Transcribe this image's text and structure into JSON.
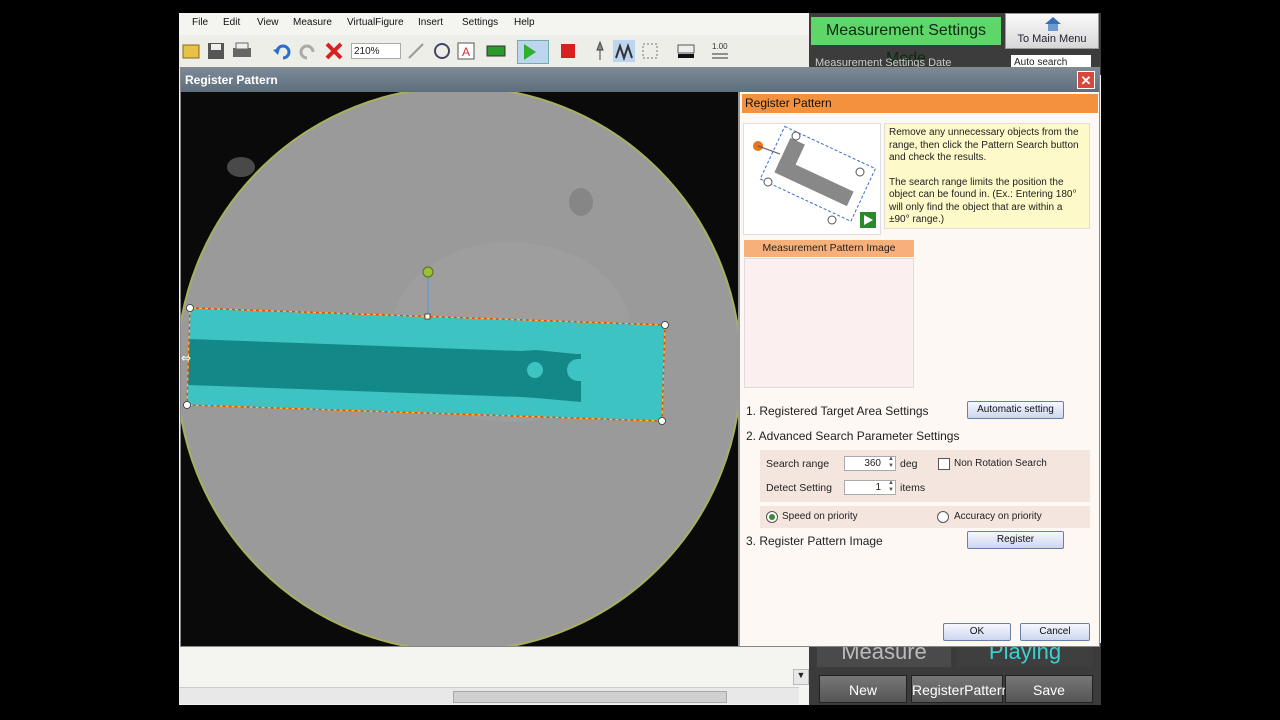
{
  "menu": [
    "File",
    "Edit",
    "View",
    "Measure",
    "VirtualFigure",
    "Insert",
    "Settings",
    "Help"
  ],
  "toolbar": {
    "zoom": "210%",
    "icons": [
      "open-icon",
      "save-icon",
      "print-icon",
      "undo-icon",
      "redo-icon",
      "delete-icon",
      "draw-icon",
      "measure-tool-icon",
      "text-icon",
      "grid-icon",
      "play-icon",
      "stop-icon",
      "edge-icon",
      "filter-icon",
      "select-icon",
      "line-color-icon",
      "line-width-icon"
    ],
    "line_width": "1.00"
  },
  "mode": {
    "label": "Measurement Settings Mode",
    "main_menu": "To Main Menu",
    "settings_date": "Measurement Settings Date",
    "auto_search": "Auto search"
  },
  "dialog": {
    "title": "Register Pattern",
    "close": "✕",
    "panel_title": "Register Pattern",
    "help_p1": "Remove any unnecessary objects from the range, then click the Pattern Search button and check the results.",
    "help_p2": "The search range limits the position the object can be found in. (Ex.: Entering 180° will only find the object that are within a ±90° range.)",
    "pattern_image_label": "Measurement Pattern Image",
    "sec1": "1. Registered Target Area Settings",
    "auto_setting": "Automatic setting",
    "sec2": "2. Advanced Search Parameter Settings",
    "search_range_label": "Search range",
    "search_range_value": "360",
    "search_range_unit": "deg",
    "non_rotation": "Non Rotation Search",
    "detect_label": "Detect Setting",
    "detect_value": "1",
    "detect_unit": "items",
    "speed_priority": "Speed on priority",
    "accuracy_priority": "Accuracy on priority",
    "sec3": "3. Register Pattern Image",
    "register": "Register",
    "ok": "OK",
    "cancel": "Cancel"
  },
  "bottom": {
    "measure": "Measure",
    "playing": "Playing",
    "new": "New",
    "register_pattern": "RegisterPattern",
    "save_settings": "Save Settings"
  }
}
